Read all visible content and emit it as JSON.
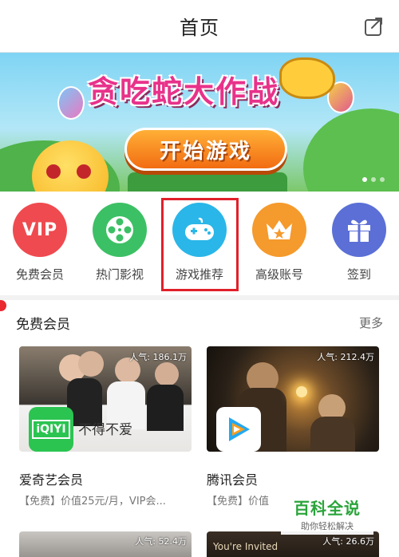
{
  "header": {
    "title": "首页"
  },
  "banner": {
    "title": "贪吃蛇大作战",
    "button_label": "开始游戏"
  },
  "quick_menu": [
    {
      "label": "免费会员",
      "icon": "vip-icon",
      "icon_text": "VIP",
      "color": "#ef4a4f"
    },
    {
      "label": "热门影视",
      "icon": "film-reel-icon",
      "color": "#3cc065"
    },
    {
      "label": "游戏推荐",
      "icon": "gamepad-icon",
      "color": "#2ab6e8"
    },
    {
      "label": "高级账号",
      "icon": "crown-icon",
      "color": "#f59a2c"
    },
    {
      "label": "签到",
      "icon": "gift-icon",
      "color": "#5b6fd6"
    }
  ],
  "section": {
    "title": "免费会员",
    "more": "更多",
    "cards": [
      {
        "name": "爱奇艺会员",
        "desc": "【免费】价值25元/月，VIP会...",
        "popularity": "人气: 186.1万",
        "logo": "iqiyi-logo",
        "logo_text": "iQIYI",
        "poster_text": "不得不爱",
        "accent": "#2bc451"
      },
      {
        "name": "腾讯会员",
        "desc": "【免费】价值",
        "popularity": "人气: 212.4万",
        "logo": "tencent-video-logo",
        "accent": "#23a8f2"
      }
    ],
    "row2": [
      {
        "popularity": "人气: 52.4万"
      },
      {
        "popularity": "人气: 26.6万",
        "poster_text": "You're Invited"
      }
    ]
  },
  "watermark": {
    "title": "百科全说",
    "subtitle": "助你轻松解决"
  }
}
